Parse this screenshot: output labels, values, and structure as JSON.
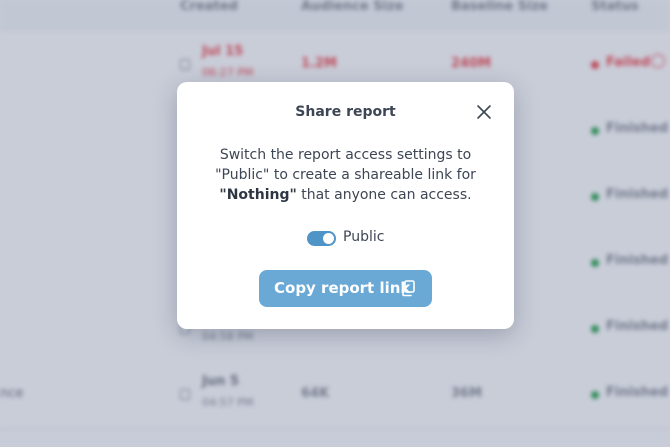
{
  "table": {
    "headers": {
      "created": "Created",
      "audience_size": "Audience Size",
      "baseline_size": "Baseline Size",
      "status": "Status"
    },
    "rows": [
      {
        "date": "Jul 15",
        "time": "06:27 PM",
        "audience": "1.2M",
        "baseline": "240M",
        "status": "Failed",
        "name": ""
      },
      {
        "date": "",
        "time": "",
        "audience": "",
        "baseline": "",
        "status": "Finished",
        "name": ""
      },
      {
        "date": "",
        "time": "",
        "audience": "",
        "baseline": "",
        "status": "Finished",
        "name": ""
      },
      {
        "date": "",
        "time": "",
        "audience": "",
        "baseline": "",
        "status": "Finished",
        "name": ""
      },
      {
        "date": "",
        "time": "04:58 PM",
        "audience": "",
        "baseline": "",
        "status": "Finished",
        "name": ""
      },
      {
        "date": "Jun 5",
        "time": "04:57 PM",
        "audience": "64K",
        "baseline": "36M",
        "status": "Finished",
        "name": "nce"
      }
    ]
  },
  "modal": {
    "title": "Share report",
    "text_before": "Switch the report access settings to \"Public\" to create a shareable link for ",
    "report_name": "\"Nothing\"",
    "text_after": " that anyone can access.",
    "toggle_label": "Public",
    "toggle_on": true,
    "copy_button_label": "Copy report link",
    "icons": {
      "close": "close-icon",
      "copy": "copy-icon",
      "calendar": "calendar-icon"
    }
  },
  "colors": {
    "accent": "#6aa9d6",
    "toggle": "#4e94c7",
    "failed": "#e8545d",
    "finished": "#3aa55d"
  }
}
